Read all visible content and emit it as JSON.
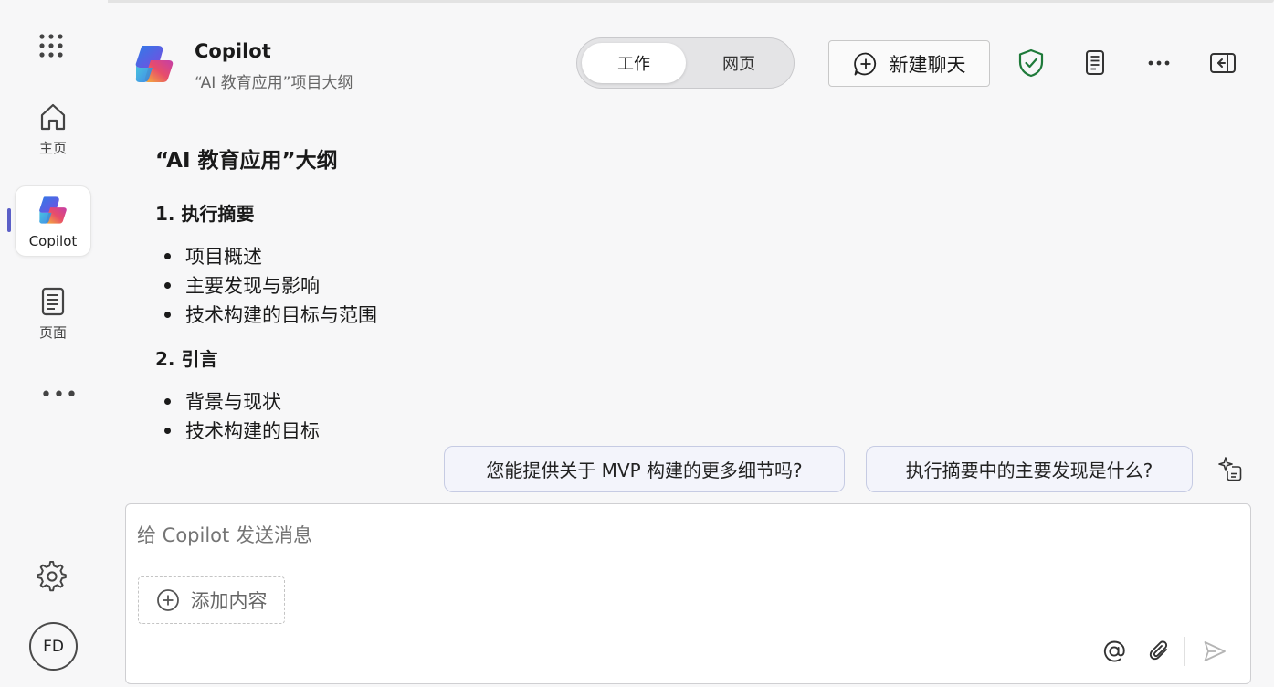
{
  "rail": {
    "home_label": "主页",
    "copilot_label": "Copilot",
    "pages_label": "页面",
    "more_label": "•••",
    "avatar_initials": "FD"
  },
  "header": {
    "title": "Copilot",
    "subtitle": "“AI 教育应用”项目大纲",
    "toggle": {
      "work": "工作",
      "web": "网页",
      "selected": "work"
    },
    "new_chat_label": "新建聊天"
  },
  "doc": {
    "title": "“AI 教育应用”大纲",
    "sections": [
      {
        "heading": "1. 执行摘要",
        "items": [
          "项目概述",
          "主要发现与影响",
          "技术构建的目标与范围"
        ]
      },
      {
        "heading": "2. 引言",
        "items": [
          "背景与现状",
          "技术构建的目标"
        ]
      }
    ]
  },
  "suggestions": [
    "您能提供关于 MVP 构建的更多细节吗?",
    "执行摘要中的主要发现是什么?"
  ],
  "composer": {
    "placeholder": "给 Copilot 发送消息",
    "add_content_label": "添加内容"
  },
  "colors": {
    "accent": "#5b5fc7",
    "shield": "#1f7a3a",
    "background": "#f7f7f8"
  }
}
